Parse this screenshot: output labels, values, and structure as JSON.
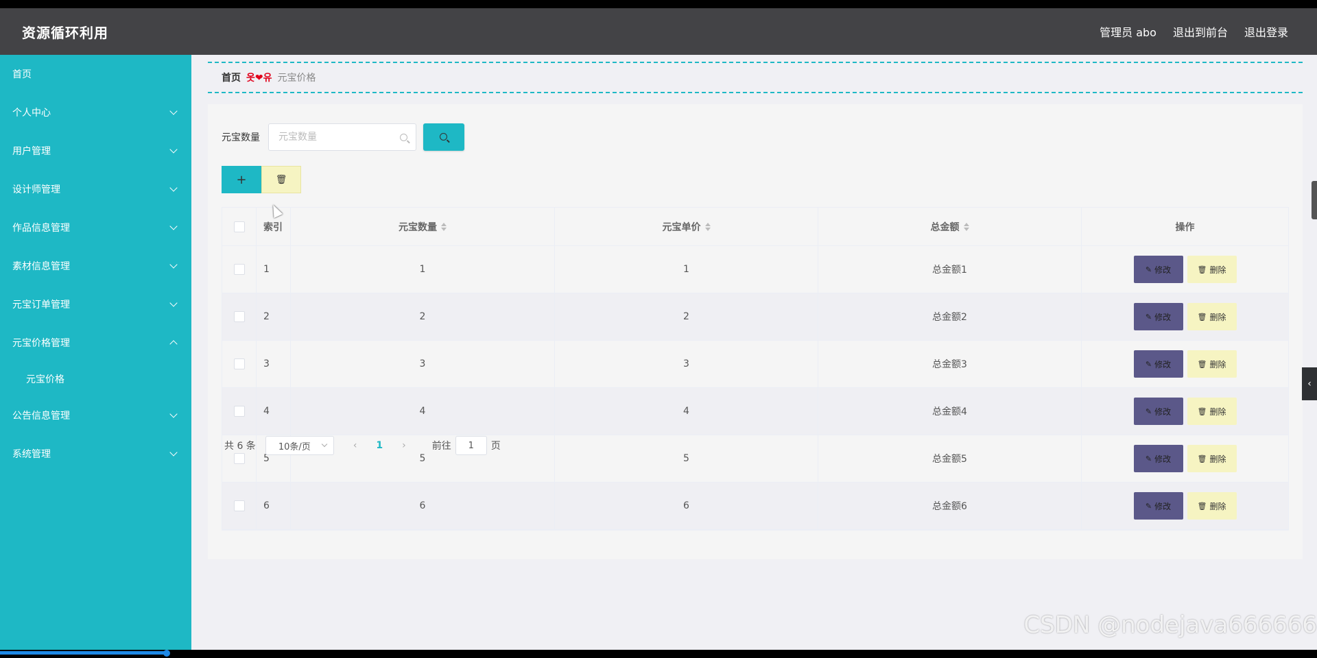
{
  "header": {
    "title": "资源循环利用",
    "admin": "管理员 abo",
    "front": "退出到前台",
    "logout": "退出登录"
  },
  "sidebar": {
    "items": [
      {
        "label": "首页"
      },
      {
        "label": "个人中心"
      },
      {
        "label": "用户管理"
      },
      {
        "label": "设计师管理"
      },
      {
        "label": "作品信息管理"
      },
      {
        "label": "素材信息管理"
      },
      {
        "label": "元宝订单管理"
      },
      {
        "label": "元宝价格管理"
      },
      {
        "label": "公告信息管理"
      },
      {
        "label": "系统管理"
      }
    ],
    "sub_item": "元宝价格"
  },
  "breadcrumb": {
    "home": "首页",
    "sep": "옷❤유",
    "current": "元宝价格"
  },
  "search": {
    "label": "元宝数量",
    "placeholder": "元宝数量"
  },
  "toolbar": {
    "add": "+",
    "delete": "🗑"
  },
  "table": {
    "headers": {
      "index": "索引",
      "qty": "元宝数量",
      "price": "元宝单价",
      "total": "总金额",
      "ops": "操作"
    },
    "rows": [
      {
        "index": "1",
        "qty": "1",
        "price": "1",
        "total": "总金额1"
      },
      {
        "index": "2",
        "qty": "2",
        "price": "2",
        "total": "总金额2"
      },
      {
        "index": "3",
        "qty": "3",
        "price": "3",
        "total": "总金额3"
      },
      {
        "index": "4",
        "qty": "4",
        "price": "4",
        "total": "总金额4"
      },
      {
        "index": "5",
        "qty": "5",
        "price": "5",
        "total": "总金额5"
      },
      {
        "index": "6",
        "qty": "6",
        "price": "6",
        "total": "总金额6"
      }
    ],
    "edit_label": "修改",
    "delete_label": "删除"
  },
  "pagination": {
    "total": "共 6 条",
    "page_size": "10条/页",
    "current": "1",
    "goto_label": "前往",
    "goto_value": "1",
    "page_suffix": "页"
  },
  "watermark": "CSDN @nodejava666666",
  "colors": {
    "header_bg": "#434346",
    "sidebar_bg": "#1eb8c5",
    "edit_btn": "#5b5889",
    "delete_btn": "#f6f4c2"
  }
}
